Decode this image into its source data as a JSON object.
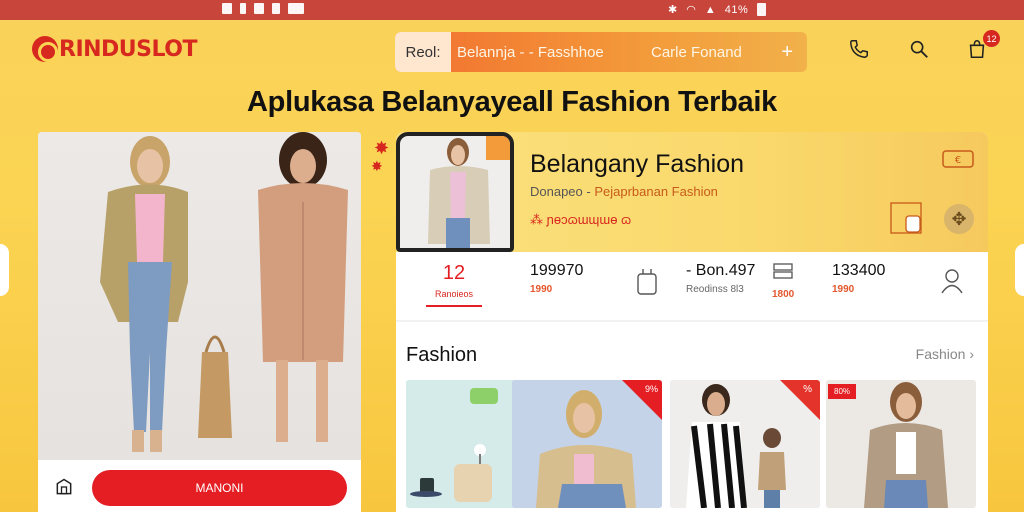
{
  "status_bar": {
    "left_text": "ꟷ ⁄ 𐑁 ⁄⁄5",
    "right_text": "41%"
  },
  "header": {
    "logo": "RINDUSLOT",
    "search": {
      "chip": "Reol:",
      "query": "Belannja - - Fasshhoe",
      "right_text": "Carle Fonand",
      "plus": "+"
    },
    "cart_badge": "12"
  },
  "headline": "Aplukasa Belanyayeall Fashion Terbaik",
  "left_card": {
    "button_label": "MANONI"
  },
  "store": {
    "title": "Belangany Fashion",
    "subtitle_a": "Donapeo - ",
    "subtitle_b": "Pejaprbanan Fashion",
    "tags": "⁂ ɲɵɔɷɯɰɯɵ ɷ"
  },
  "stats": [
    {
      "number": "12",
      "sub": "Ranoieos"
    },
    {
      "number": "199970",
      "sub": "1990"
    },
    {
      "number": "- Bon.497",
      "sub": "Reodinss 8l3"
    },
    {
      "number": "",
      "sub": "1800"
    },
    {
      "number": "133400",
      "sub": "1990"
    }
  ],
  "section": {
    "title": "Fashion",
    "link": "Fashion ›"
  },
  "thumbs": [
    {
      "badge": "~"
    },
    {
      "badge": "9%"
    },
    {
      "badge": "%"
    },
    {
      "badge": "80%"
    }
  ],
  "colors": {
    "brand_red": "#d7281f",
    "accent_orange": "#f26f2f",
    "background_yellow": "#fbd453"
  }
}
